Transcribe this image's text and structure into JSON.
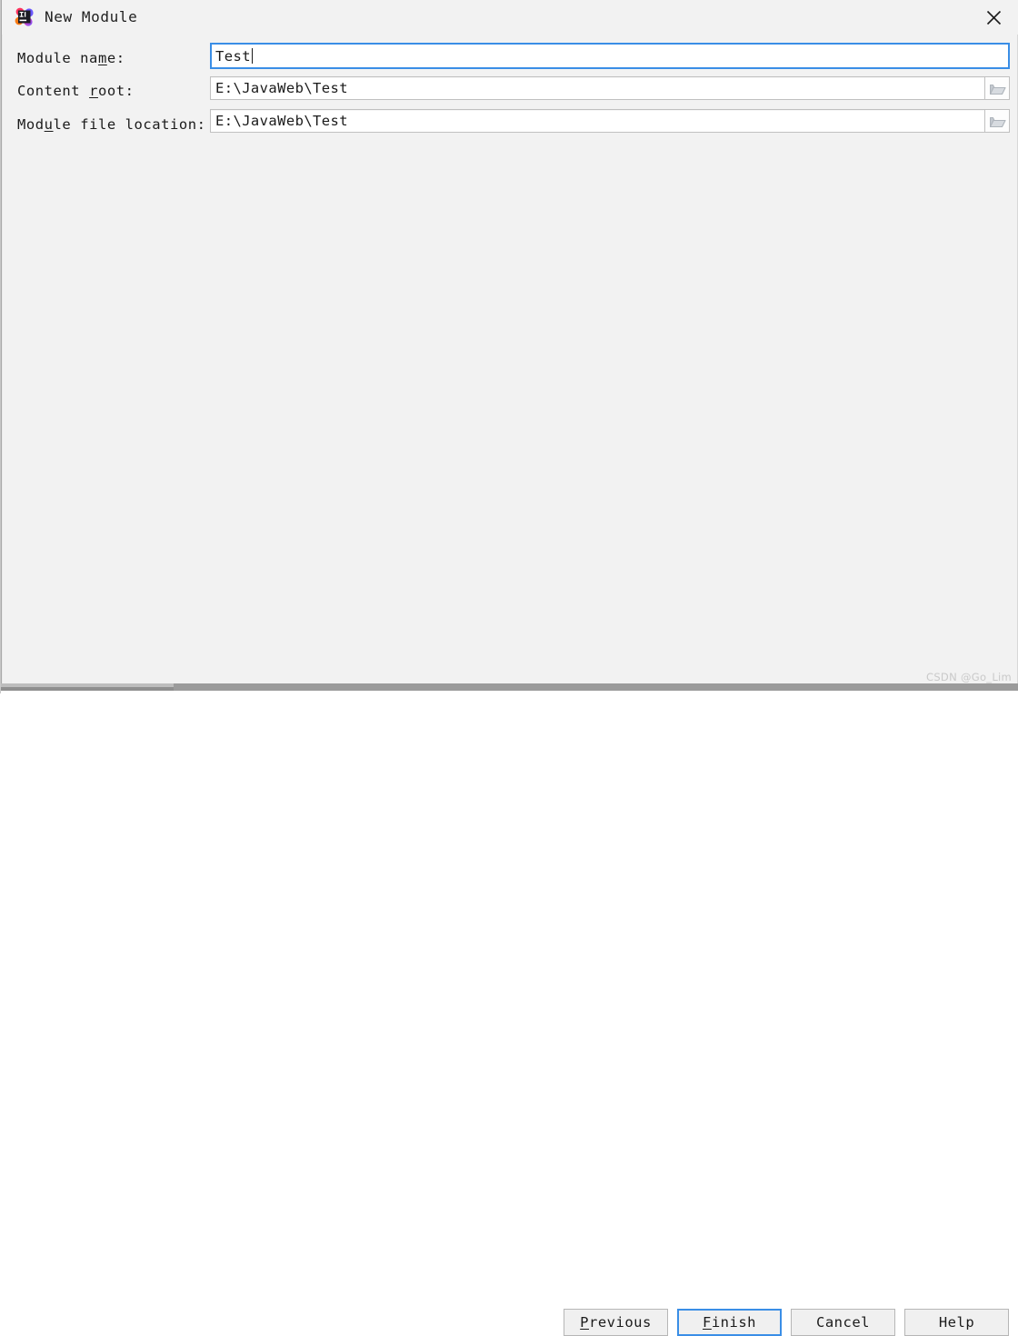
{
  "window": {
    "title": "New Module",
    "icon": "intellij-idea-logo-icon",
    "close_label": "×",
    "background_color": "#f2f2f2"
  },
  "form": {
    "rows": [
      {
        "label_before": "Module na",
        "label_mnemonic": "m",
        "label_after": "e:",
        "value": "Test",
        "placeholder": "",
        "focused": true,
        "has_browse": false
      },
      {
        "label_before": "Content ",
        "label_mnemonic": "r",
        "label_after": "oot:",
        "value": "E:\\JavaWeb\\Test",
        "placeholder": "",
        "focused": false,
        "has_browse": true,
        "browse_icon": "folder-icon"
      },
      {
        "label_before": "Mod",
        "label_mnemonic": "u",
        "label_after": "le file location:",
        "value": "E:\\JavaWeb\\Test",
        "placeholder": "",
        "focused": false,
        "has_browse": true,
        "browse_icon": "folder-icon"
      }
    ]
  },
  "buttons": [
    {
      "before": "",
      "mnemonic": "P",
      "after": "revious",
      "default": false
    },
    {
      "before": "",
      "mnemonic": "F",
      "after": "inish",
      "default": true
    },
    {
      "before": "Cancel",
      "mnemonic": "",
      "after": "",
      "default": false
    },
    {
      "before": "Help",
      "mnemonic": "",
      "after": "",
      "default": false
    }
  ],
  "watermark": {
    "text": "CSDN @Go_Lim"
  },
  "colors": {
    "focus_blue": "#3a8ee6",
    "dialog_bg": "#f2f2f2",
    "field_bg": "#ffffff",
    "text": "#1b1b1b",
    "watermark": "#c9c9c9"
  }
}
